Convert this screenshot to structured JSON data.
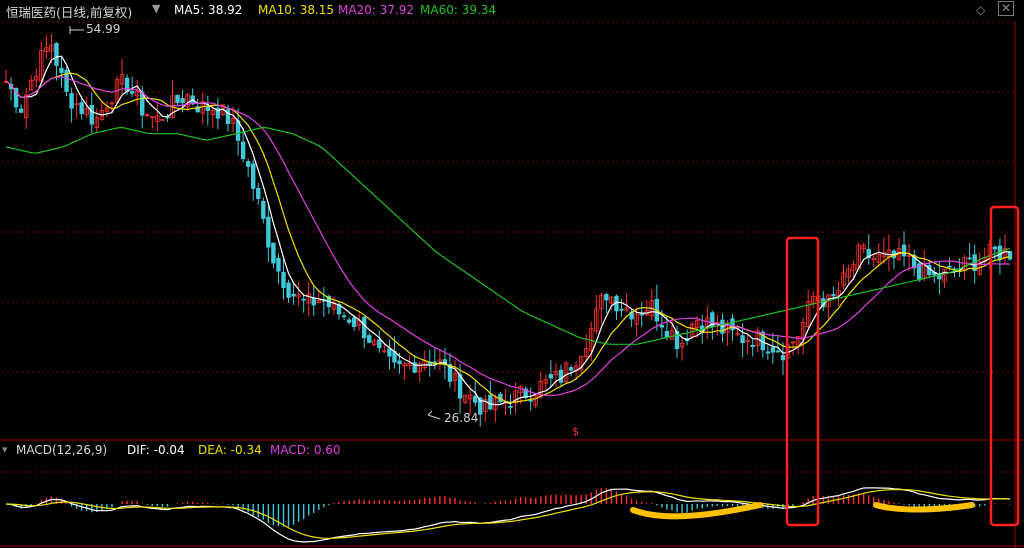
{
  "header": {
    "title": "恒瑞医药(日线,前复权)",
    "ma5": "MA5: 38.92",
    "ma10": "MA10: 38.15",
    "ma20": "MA20: 37.92",
    "ma60": "MA60: 39.34",
    "dropdown_icon": "chevron-down-icon",
    "collapse_icon": "diamond-icon",
    "close_icon": "close-icon"
  },
  "macd_header": {
    "title": "MACD(12,26,9)",
    "dif": "DIF: -0.04",
    "dea": "DEA: -0.34",
    "macd": "MACD: 0.60"
  },
  "annotations": {
    "high": "54.99",
    "low": "26.84",
    "marker": "$"
  },
  "colors": {
    "background": "#000000",
    "up": "#ff3030",
    "down": "#40c8d8",
    "ma5": "#ffffff",
    "ma10": "#f0e000",
    "ma20": "#e040e0",
    "ma60": "#20c020",
    "grid": "#7a0000",
    "highlight_box": "#ff2020",
    "highlight_stroke": "#ffc000"
  },
  "chart_data": {
    "type": "line",
    "title": "恒瑞医药(日线,前复权)",
    "price_high": 54.99,
    "price_low": 26.84,
    "series": [
      {
        "name": "MA5",
        "last": 38.92
      },
      {
        "name": "MA10",
        "last": 38.15
      },
      {
        "name": "MA20",
        "last": 37.92
      },
      {
        "name": "MA60",
        "last": 39.34
      }
    ],
    "macd": {
      "dif": -0.04,
      "dea": -0.34,
      "macd": 0.6
    },
    "close_path": [
      52,
      50,
      53,
      55,
      51,
      50,
      49,
      51,
      52,
      50,
      49,
      50,
      51,
      50,
      50,
      49,
      46,
      42,
      38,
      36,
      35,
      35.5,
      34.5,
      34,
      33,
      31,
      30,
      30.5,
      31,
      30.5,
      29,
      28,
      27,
      27.5,
      28,
      28.5,
      29,
      29.5,
      31,
      33,
      36,
      35,
      34.5,
      35,
      33.5,
      32,
      34,
      33.5,
      33,
      32.5,
      32.5,
      32,
      31.5,
      33,
      36,
      35,
      37,
      39,
      38.5,
      38.5,
      38.5,
      37.5,
      37,
      37.5,
      38,
      38.5,
      39,
      39
    ],
    "ma60_path": [
      47,
      46.5,
      47,
      48,
      48.5,
      48,
      48,
      47.5,
      48,
      48.5,
      48,
      47,
      45,
      43,
      41,
      39,
      37.5,
      36,
      34.5,
      33.5,
      32.5,
      32,
      32,
      32.5,
      33,
      33.5,
      34,
      34.5,
      35,
      35.5,
      36,
      36.5,
      37,
      37.5,
      38.5,
      39.3
    ]
  }
}
